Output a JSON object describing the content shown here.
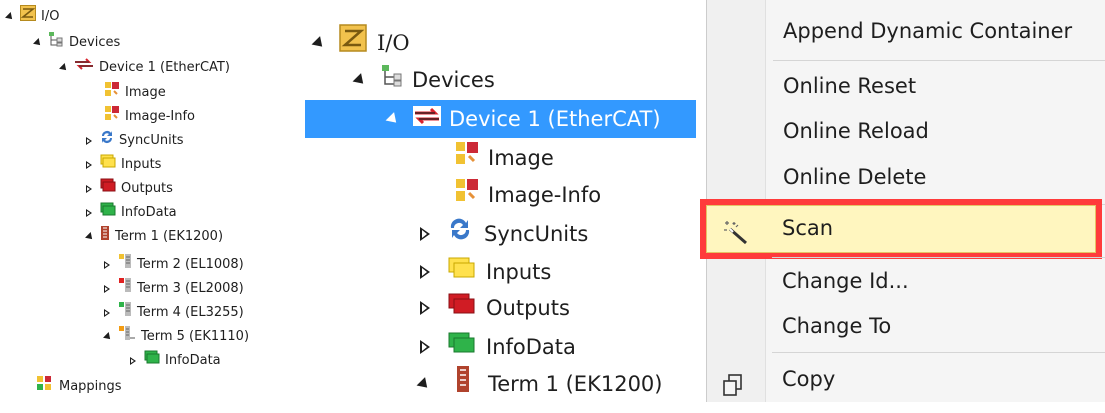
{
  "small_tree": {
    "io": "I/O",
    "devices": "Devices",
    "device1": "Device 1 (EtherCAT)",
    "image": "Image",
    "image_info": "Image-Info",
    "syncunits": "SyncUnits",
    "inputs": "Inputs",
    "outputs": "Outputs",
    "infodata": "InfoData",
    "term1": "Term 1 (EK1200)",
    "term2": "Term 2 (EL1008)",
    "term3": "Term 3 (EL2008)",
    "term4": "Term 4 (EL3255)",
    "term5": "Term 5 (EK1110)",
    "term5_infodata": "InfoData",
    "mappings": "Mappings"
  },
  "big_tree": {
    "io": "I/O",
    "devices": "Devices",
    "device1": "Device 1 (EtherCAT)",
    "image": "Image",
    "image_info": "Image-Info",
    "syncunits": "SyncUnits",
    "inputs": "Inputs",
    "outputs": "Outputs",
    "infodata": "InfoData",
    "term1": "Term 1 (EK1200)"
  },
  "context_menu": {
    "append_dynamic_container": "Append Dynamic Container",
    "online_reset": "Online Reset",
    "online_reload": "Online Reload",
    "online_delete": "Online Delete",
    "scan": "Scan",
    "change_id": "Change Id...",
    "change_to": "Change To",
    "copy": "Copy"
  },
  "colors": {
    "selection": "#3399ff",
    "highlight_border": "#ff3b3b",
    "hover_fill": "#fff6bf"
  }
}
